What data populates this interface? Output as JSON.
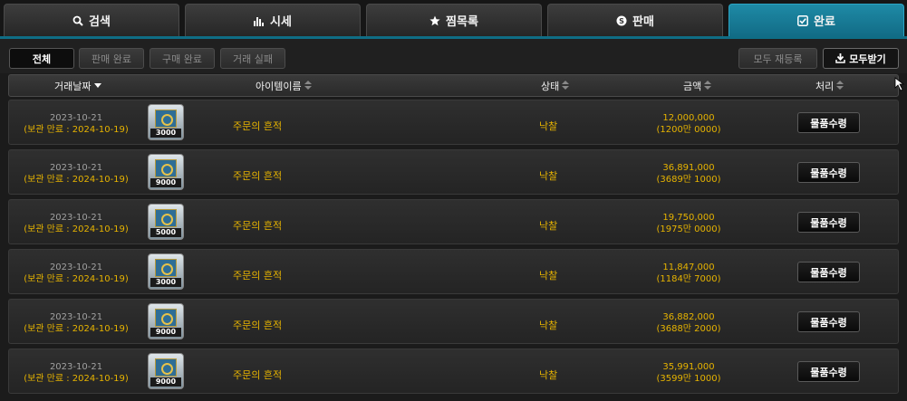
{
  "tabs": [
    {
      "label": "검색",
      "icon": "search-icon"
    },
    {
      "label": "시세",
      "icon": "bar-chart-icon"
    },
    {
      "label": "찜목록",
      "icon": "star-icon"
    },
    {
      "label": "판매",
      "icon": "coin-icon"
    },
    {
      "label": "완료",
      "icon": "checkbox-icon",
      "active": true
    }
  ],
  "filters": {
    "all": "전체",
    "sale_done": "판매 완료",
    "buy_done": "구매 완료",
    "trade_fail": "거래 실패",
    "relist_all": "모두 재등록",
    "receive_all": "모두받기"
  },
  "columns": {
    "date": "거래날짜",
    "item": "아이템이름",
    "status": "상태",
    "amount": "금액",
    "action": "처리"
  },
  "rows": [
    {
      "date": "2023-10-21",
      "expiry": "(보관 만료 : 2024-10-19)",
      "icon_num": "3000",
      "item": "주문의 흔적",
      "status": "낙찰",
      "price": "12,000,000",
      "price_sub": "(1200만 0000)",
      "action": "물품수령"
    },
    {
      "date": "2023-10-21",
      "expiry": "(보관 만료 : 2024-10-19)",
      "icon_num": "9000",
      "item": "주문의 흔적",
      "status": "낙찰",
      "price": "36,891,000",
      "price_sub": "(3689만 1000)",
      "action": "물품수령"
    },
    {
      "date": "2023-10-21",
      "expiry": "(보관 만료 : 2024-10-19)",
      "icon_num": "5000",
      "item": "주문의 흔적",
      "status": "낙찰",
      "price": "19,750,000",
      "price_sub": "(1975만 0000)",
      "action": "물품수령"
    },
    {
      "date": "2023-10-21",
      "expiry": "(보관 만료 : 2024-10-19)",
      "icon_num": "3000",
      "item": "주문의 흔적",
      "status": "낙찰",
      "price": "11,847,000",
      "price_sub": "(1184만 7000)",
      "action": "물품수령"
    },
    {
      "date": "2023-10-21",
      "expiry": "(보관 만료 : 2024-10-19)",
      "icon_num": "9000",
      "item": "주문의 흔적",
      "status": "낙찰",
      "price": "36,882,000",
      "price_sub": "(3688만 2000)",
      "action": "물품수령"
    },
    {
      "date": "2023-10-21",
      "expiry": "(보관 만료 : 2024-10-19)",
      "icon_num": "9000",
      "item": "주문의 흔적",
      "status": "낙찰",
      "price": "35,991,000",
      "price_sub": "(3599만 1000)",
      "action": "물품수령"
    }
  ],
  "colors": {
    "accent": "#147a96",
    "gold": "#e6b300"
  }
}
